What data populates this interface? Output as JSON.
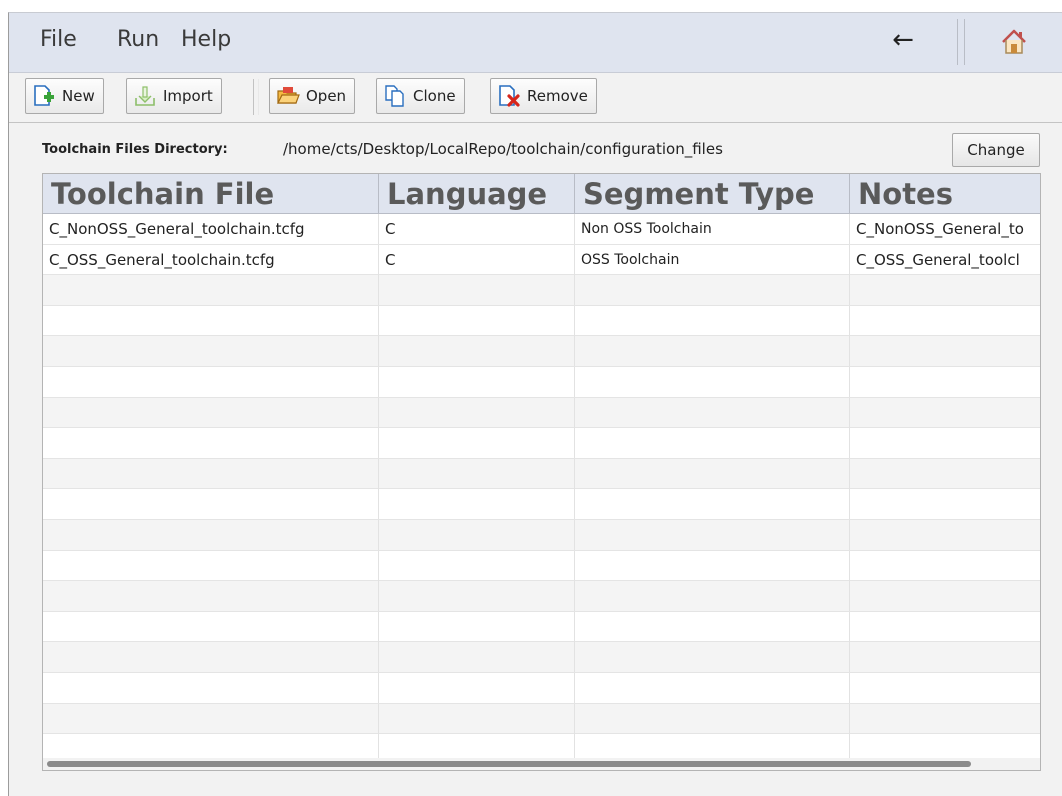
{
  "menubar": {
    "file": "File",
    "run": "Run",
    "help": "Help",
    "back_icon": "←"
  },
  "toolbar": {
    "new": "New",
    "import": "Import",
    "open": "Open",
    "clone": "Clone",
    "remove": "Remove"
  },
  "directory": {
    "label": "Toolchain Files Directory:",
    "path": "/home/cts/Desktop/LocalRepo/toolchain/configuration_files",
    "change": "Change"
  },
  "table": {
    "columns": [
      "Toolchain File",
      "Language",
      "Segment Type",
      "Notes"
    ],
    "rows": [
      [
        "C_NonOSS_General_toolchain.tcfg",
        "C",
        "Non OSS Toolchain",
        "C_NonOSS_General_to"
      ],
      [
        "C_OSS_General_toolchain.tcfg",
        "C",
        "OSS Toolchain",
        "C_OSS_General_toolcl"
      ]
    ]
  },
  "colors": {
    "menubar_bg": "#dfe4ef",
    "header_bg": "#dfe4ef",
    "toolbar_bg": "#f2f2f2"
  },
  "icons": {
    "back": "back-arrow-icon",
    "home": "home-icon",
    "new": "new-file-icon",
    "import": "import-icon",
    "open": "open-folder-icon",
    "clone": "clone-icon",
    "remove": "remove-file-icon"
  }
}
